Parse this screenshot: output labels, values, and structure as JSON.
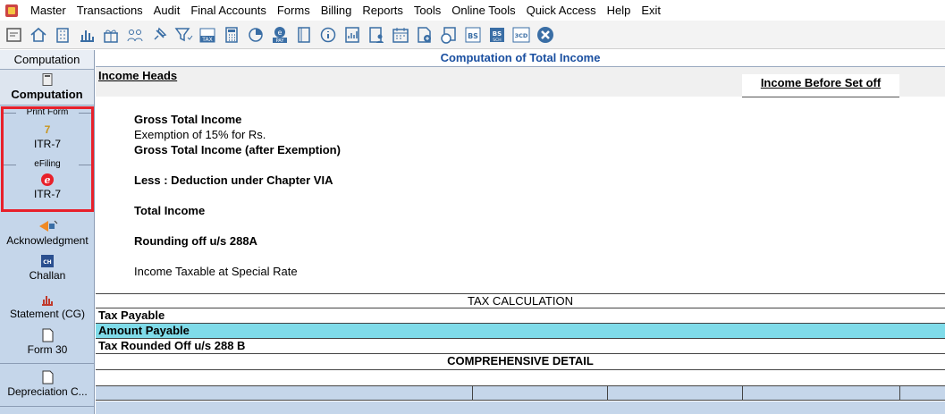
{
  "menu": [
    "Master",
    "Transactions",
    "Audit",
    "Final Accounts",
    "Forms",
    "Billing",
    "Reports",
    "Tools",
    "Online Tools",
    "Quick Access",
    "Help",
    "Exit"
  ],
  "toolbar_icons": [
    "open-icon",
    "home-icon",
    "building-icon",
    "bar-chart-icon",
    "gift-icon",
    "users-icon",
    "pin-icon",
    "filter-icon",
    "tax-icon",
    "calculator-icon",
    "pie-chart-icon",
    "epay-icon",
    "book-icon",
    "info-icon",
    "report-icon",
    "person-report-icon",
    "calendar-icon",
    "add-doc-icon",
    "refresh-doc-icon",
    "bs-icon",
    "bs-sch-icon",
    "3cd-icon",
    "close-circle-icon"
  ],
  "sidebar": {
    "header": "Computation",
    "computation": "Computation",
    "print_form_label": "Print Form",
    "print_form_glyph": "7",
    "itr7_print": "ITR-7",
    "efiling_label": "eFiling",
    "itr7_efile": "ITR-7",
    "acknowledgment": "Acknowledgment",
    "challan": "Challan",
    "statement": "Statement (CG)",
    "form30": "Form 30",
    "depreciation": "Depreciation C..."
  },
  "main": {
    "title": "Computation of Total Income",
    "income_heads": "Income Heads",
    "col_header": "Income Before Set off",
    "lines": {
      "gross_total": "Gross Total Income",
      "exemption": "Exemption of 15% for Rs.",
      "gross_after": "Gross Total Income (after Exemption)",
      "less_deduction": "Less : Deduction under Chapter VIA",
      "total_income": "Total Income",
      "rounding": "Rounding off u/s 288A",
      "special_rate": "Income Taxable at Special Rate"
    },
    "tax": {
      "heading": "TAX CALCULATION",
      "payable": "Tax Payable",
      "amount_payable": "Amount Payable",
      "rounded": "Tax Rounded Off u/s 288 B",
      "comprehensive": "COMPREHENSIVE DETAIL"
    }
  },
  "colors": {
    "title": "#1a4fa0",
    "highlight": "#7fdbe9",
    "sidebar": "#c5d6ea",
    "red_outline": "#e8202a"
  }
}
